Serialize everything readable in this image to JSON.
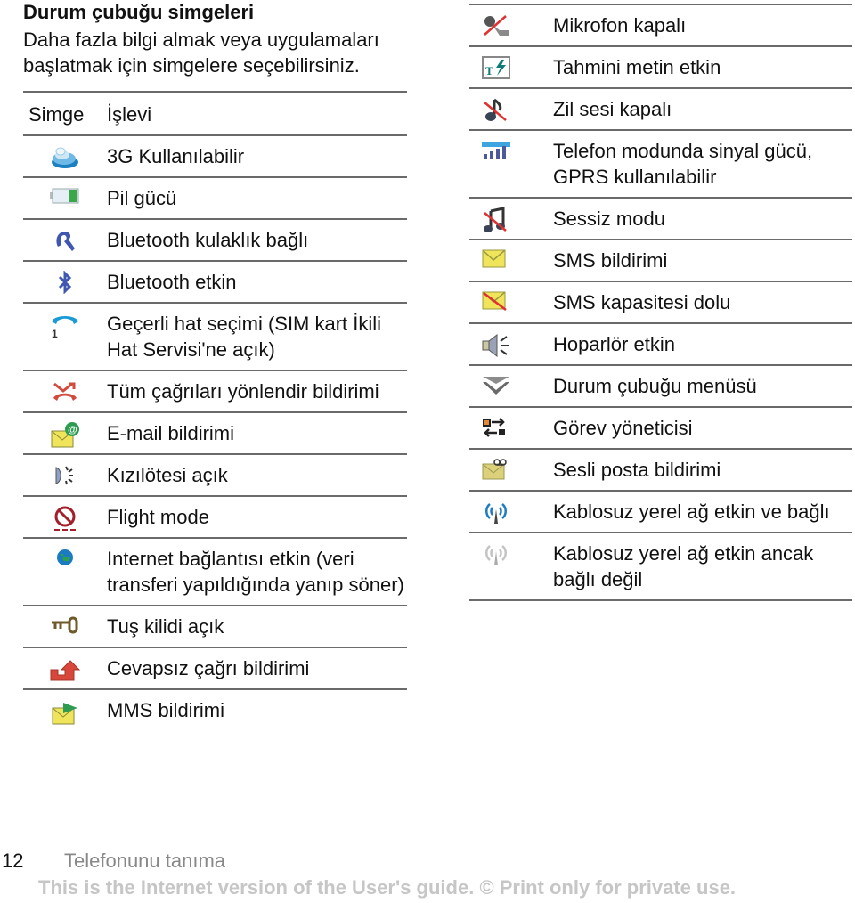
{
  "heading": "Durum çubuğu simgeleri",
  "intro": "Daha fazla bilgi almak veya uygulamaları başlatmak için simgelere seçebilirsiniz.",
  "table_header": {
    "icon_col": "Simge",
    "function_col": "İşlevi"
  },
  "left_rows": [
    {
      "icon": "3g-icon",
      "text": "3G Kullanılabilir"
    },
    {
      "icon": "battery-icon",
      "text": "Pil gücü"
    },
    {
      "icon": "bluetooth-headset-icon",
      "text": "Bluetooth kulaklık bağlı"
    },
    {
      "icon": "bluetooth-icon",
      "text": "Bluetooth etkin"
    },
    {
      "icon": "phone-line-1-icon",
      "text": "Geçerli hat seçimi (SIM kart İkili Hat Servisi'ne açık)"
    },
    {
      "icon": "call-divert-icon",
      "text": "Tüm çağrıları yönlendir bildirimi"
    },
    {
      "icon": "email-icon",
      "text": "E-mail bildirimi"
    },
    {
      "icon": "infrared-icon",
      "text": "Kızılötesi açık"
    },
    {
      "icon": "flight-mode-icon",
      "text": "Flight mode"
    },
    {
      "icon": "globe-icon",
      "text": "Internet bağlantısı etkin (veri transferi yapıldığında yanıp söner)"
    },
    {
      "icon": "keylock-icon",
      "text": "Tuş kilidi açık"
    },
    {
      "icon": "missed-call-icon",
      "text": "Cevapsız çağrı bildirimi"
    },
    {
      "icon": "mms-icon",
      "text": "MMS bildirimi"
    }
  ],
  "right_rows": [
    {
      "icon": "microphone-off-icon",
      "text": "Mikrofon kapalı"
    },
    {
      "icon": "predictive-text-icon",
      "text": "Tahmini metin etkin"
    },
    {
      "icon": "ringtone-off-icon",
      "text": "Zil sesi kapalı"
    },
    {
      "icon": "signal-strength-icon",
      "text": "Telefon modunda sinyal gücü, GPRS kullanılabilir"
    },
    {
      "icon": "silent-mode-icon",
      "text": "Sessiz modu"
    },
    {
      "icon": "sms-icon",
      "text": "SMS bildirimi"
    },
    {
      "icon": "sms-full-icon",
      "text": "SMS kapasitesi dolu"
    },
    {
      "icon": "speaker-icon",
      "text": "Hoparlör etkin"
    },
    {
      "icon": "status-menu-icon",
      "text": "Durum çubuğu menüsü"
    },
    {
      "icon": "task-manager-icon",
      "text": "Görev yöneticisi"
    },
    {
      "icon": "voicemail-icon",
      "text": "Sesli posta bildirimi"
    },
    {
      "icon": "wlan-connected-icon",
      "text": "Kablosuz yerel ağ etkin ve bağlı"
    },
    {
      "icon": "wlan-disconnected-icon",
      "text": "Kablosuz yerel ağ etkin ancak bağlı değil"
    }
  ],
  "footer": {
    "page_number": "12",
    "section": "Telefonunu tanıma",
    "notice": "This is the Internet version of the User's guide. © Print only for private use."
  }
}
